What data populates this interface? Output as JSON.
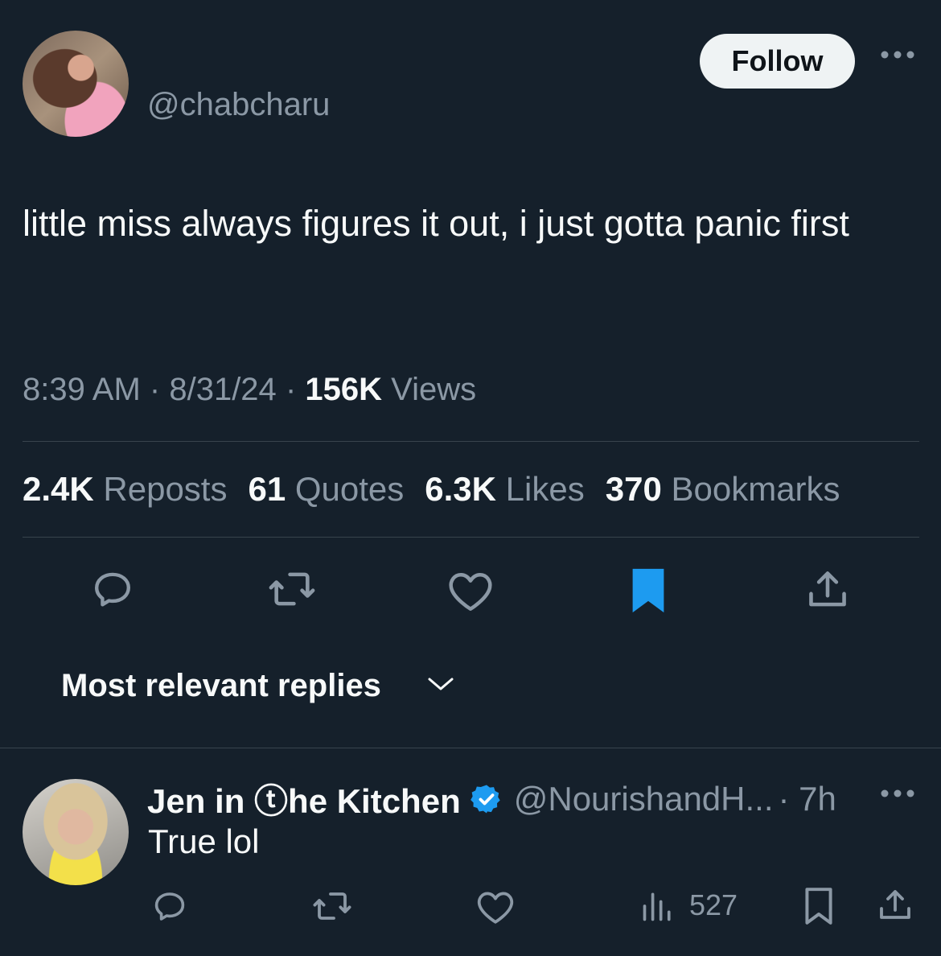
{
  "tweet": {
    "handle": "@chabcharu",
    "follow_label": "Follow",
    "text": "little miss always figures it out, i just gotta panic first",
    "time": "8:39 AM",
    "date": "8/31/24",
    "views_count": "156K",
    "views_label": "Views",
    "separator": "·",
    "stats": {
      "reposts_count": "2.4K",
      "reposts_label": "Reposts",
      "quotes_count": "61",
      "quotes_label": "Quotes",
      "likes_count": "6.3K",
      "likes_label": "Likes",
      "bookmarks_count": "370",
      "bookmarks_label": "Bookmarks"
    },
    "bookmarked": true
  },
  "replies_sort": {
    "label": "Most relevant replies"
  },
  "reply": {
    "name": "Jen in ⓣhe Kitchen",
    "handle": "@NourishandH...",
    "time": "· 7h",
    "text": "True lol",
    "views_count": "527",
    "verified": true
  },
  "colors": {
    "background": "#15202b",
    "text_primary": "#f7f9f9",
    "text_secondary": "#8b98a5",
    "accent": "#1d9bf0",
    "divider": "#38444d"
  }
}
